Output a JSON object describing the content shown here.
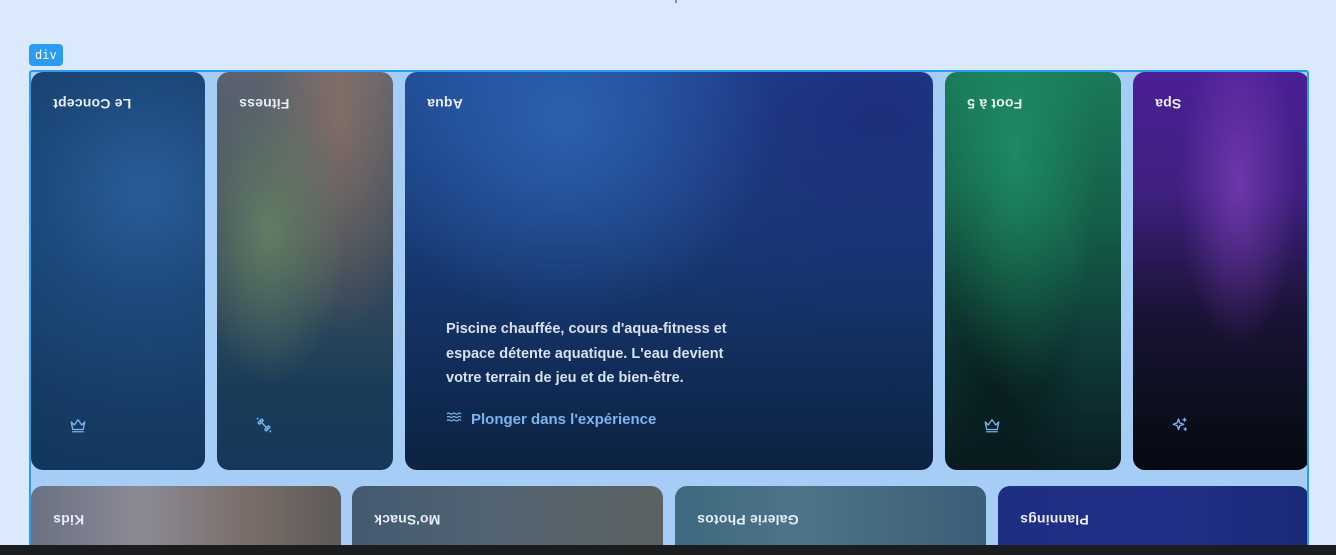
{
  "badge": {
    "label": "div"
  },
  "cards": {
    "concept": {
      "title": "Le Concept",
      "icon": "crown-icon"
    },
    "fitness": {
      "title": "Fitness",
      "icon": "dumbbell-icon"
    },
    "aqua": {
      "title": "Aqua",
      "description": "Piscine chauffée, cours d'aqua-fitness et espace détente aquatique. L'eau devient votre terrain de jeu et de bien-être.",
      "link_label": "Plonger dans l'expérience",
      "link_icon": "waves-icon"
    },
    "foot": {
      "title": "Foot à 5",
      "icon": "crown-icon"
    },
    "spa": {
      "title": "Spa",
      "icon": "sparkles-icon"
    },
    "kids": {
      "title": "Kids"
    },
    "snack": {
      "title": "Mo'Snack"
    },
    "galerie": {
      "title": "Galerie Photos"
    },
    "plannings": {
      "title": "Plannings"
    }
  },
  "colors": {
    "frame_border": "#2c9cf3",
    "page_background": "#dbe9fd",
    "link": "#7bb4ee"
  }
}
